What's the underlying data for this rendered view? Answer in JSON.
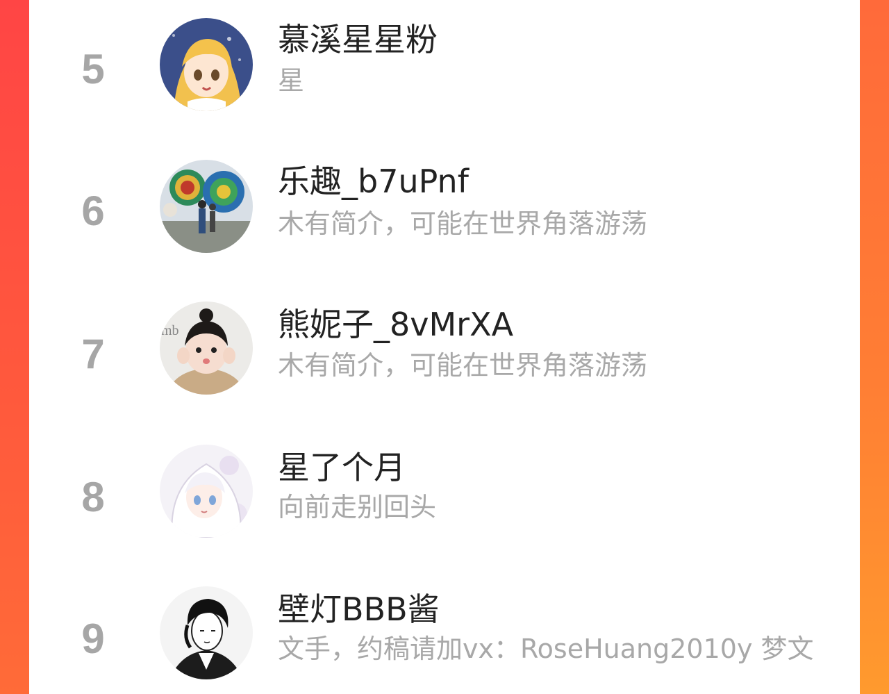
{
  "list": {
    "items": [
      {
        "rank": "5",
        "name": "慕溪星星粉",
        "bio": "星",
        "avatar": "anime-girl-avatar"
      },
      {
        "rank": "6",
        "name": "乐趣_b7uPnf",
        "bio": "木有简介，可能在世界角落游荡",
        "avatar": "peacock-photo-avatar"
      },
      {
        "rank": "7",
        "name": "熊妮子_8vMrXA",
        "bio": "木有简介，可能在世界角落游荡",
        "avatar": "child-photo-avatar"
      },
      {
        "rank": "8",
        "name": "星了个月",
        "bio": "向前走别回头",
        "avatar": "anime-white-hair-avatar"
      },
      {
        "rank": "9",
        "name": "壁灯BBB酱",
        "bio": "文手，约稿请加vx：RoseHuang2010y 梦文",
        "avatar": "manga-man-avatar"
      }
    ]
  },
  "colors": {
    "rank_gray": "#a6a6a6",
    "name_text": "#222222",
    "bio_text": "#a8a8a8",
    "frame_red": "#ff4a3d",
    "frame_orange": "#ff8a30"
  }
}
